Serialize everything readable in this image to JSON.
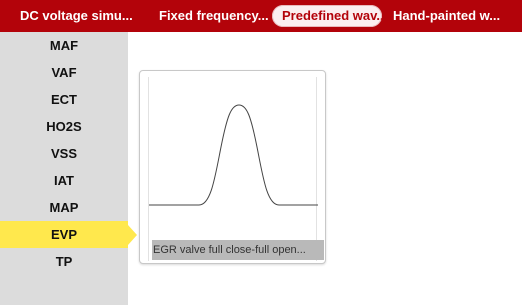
{
  "tabs": [
    {
      "label": "DC voltage simu...",
      "active": false
    },
    {
      "label": "Fixed frequency...",
      "active": false
    },
    {
      "label": "Predefined wav...",
      "active": true
    },
    {
      "label": "Hand-painted w...",
      "active": false
    }
  ],
  "sidebar": {
    "items": [
      {
        "label": "MAF"
      },
      {
        "label": "VAF"
      },
      {
        "label": "ECT"
      },
      {
        "label": "HO2S"
      },
      {
        "label": "VSS"
      },
      {
        "label": "IAT"
      },
      {
        "label": "MAP"
      },
      {
        "label": "EVP",
        "selected": true
      },
      {
        "label": "TP"
      }
    ]
  },
  "waveform_card": {
    "caption": "EGR valve full close-full open..."
  },
  "colors": {
    "header": "#b3030a",
    "sidebar": "#dcdcdc",
    "selected": "#ffe84d"
  }
}
